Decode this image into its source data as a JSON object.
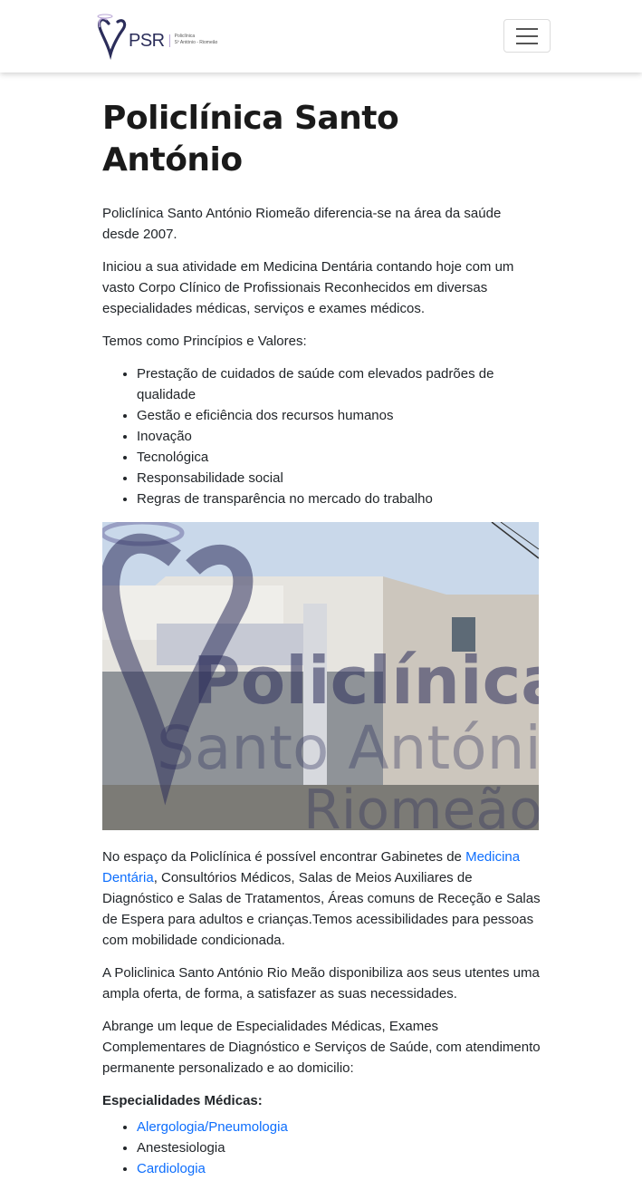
{
  "logo": {
    "brand": "PSR",
    "line1": "Policlínica",
    "line2": "Sº António - Riomeão"
  },
  "page": {
    "title": "Policlínica Santo António",
    "intro": "Policlínica Santo António Riomeão diferencia-se na área da saúde desde 2007.",
    "paragraph2": "Iniciou a sua atividade em Medicina Dentária contando hoje com um vasto Corpo Clínico de Profissionais Reconhecidos em diversas especialidades médicas, serviços e exames médicos.",
    "values_heading": "Temos como Princípios e Valores:",
    "values": [
      "Prestação de cuidados de saúde com elevados padrões de qualidade",
      "Gestão e eficiência dos recursos humanos",
      "Inovação",
      "Tecnológica",
      "Responsabilidade social",
      "Regras de transparência no mercado do trabalho"
    ],
    "photo_watermark": {
      "line1": "Policlínica",
      "line2": "Santo António",
      "line3": "Riomeão"
    },
    "facilities_before": "No espaço da Policlínica é possível encontrar Gabinetes de ",
    "facilities_link": "Medicina Dentária",
    "facilities_after": ", Consultórios Médicos, Salas de Meios Auxiliares de Diagnóstico e Salas de Tratamentos, Áreas comuns de Receção e Salas de Espera para adultos e crianças.Temos acessibilidades para pessoas com mobilidade condicionada.",
    "offer": "A Policlinica Santo António Rio Meão disponibiliza aos seus utentes uma ampla oferta, de forma, a satisfazer as suas necessidades.",
    "range": "Abrange um leque de Especialidades Médicas, Exames Complementares de Diagnóstico e Serviços de Saúde, com atendimento permanente personalizado e ao domicilio:",
    "specialties_heading": "Especialidades Médicas:",
    "specialties": [
      {
        "label": "Alergologia/Pneumologia",
        "link": true
      },
      {
        "label": "Anestesiologia",
        "link": false
      },
      {
        "label": "Cardiologia",
        "link": true
      }
    ]
  },
  "colors": {
    "link": "#0d6efd",
    "brand": "#2b2d5a"
  }
}
